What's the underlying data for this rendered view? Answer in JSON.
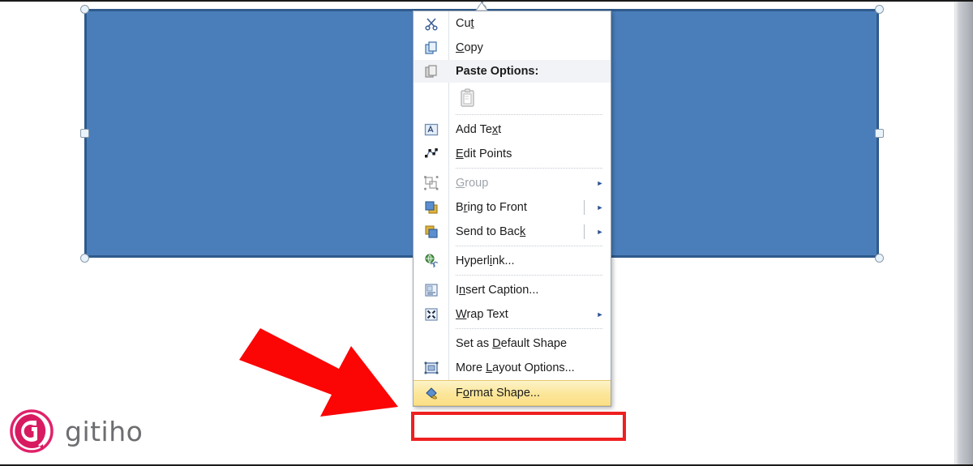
{
  "app": {
    "context": "word-shape-context-menu",
    "canvas_background": "#ffffff"
  },
  "shape": {
    "name": "blue-rectangle-shape",
    "fill_color": "#4a7ebb",
    "border_color": "#2f5a8c",
    "selected": true,
    "handles": [
      "top-left",
      "top-right",
      "bottom-left",
      "bottom-right",
      "middle-left",
      "middle-right",
      "rotation"
    ]
  },
  "annotation": {
    "arrow_color": "#ff0000",
    "highlight_box_color": "#ef2020",
    "highlight_target": "Format Shape..."
  },
  "logo": {
    "name": "gitiho",
    "text": "gitiho",
    "mark_color": "#e0226a",
    "text_color": "#6d6e71"
  },
  "context_menu": {
    "items": [
      {
        "id": "cut",
        "label": "Cut",
        "icon": "scissors-icon",
        "accel": "t",
        "type": "item",
        "disabled": false,
        "submenu": false,
        "separator_below": false
      },
      {
        "id": "copy",
        "label": "Copy",
        "icon": "copy-icon",
        "accel": "C",
        "type": "item",
        "disabled": false,
        "submenu": false,
        "separator_below": false
      },
      {
        "id": "paste-options",
        "label": "Paste Options:",
        "icon": "paste-icon",
        "type": "header",
        "disabled": false,
        "submenu": false,
        "separator_below": false
      },
      {
        "id": "paste-keep-source",
        "label": "",
        "icon": "clipboard-document-icon",
        "type": "paste-button-row",
        "disabled": true,
        "submenu": false,
        "separator_below": true
      },
      {
        "id": "add-text",
        "label": "Add Text",
        "icon": "add-text-icon",
        "accel": "x",
        "type": "item",
        "disabled": false,
        "submenu": false,
        "separator_below": false
      },
      {
        "id": "edit-points",
        "label": "Edit Points",
        "icon": "edit-points-icon",
        "accel": "E",
        "type": "item",
        "disabled": false,
        "submenu": false,
        "separator_below": true
      },
      {
        "id": "group",
        "label": "Group",
        "icon": "group-icon",
        "accel": "G",
        "type": "item",
        "disabled": true,
        "submenu": true,
        "separator_below": false
      },
      {
        "id": "bring-to-front",
        "label": "Bring to Front",
        "icon": "bring-to-front-icon",
        "accel": "r",
        "type": "item",
        "disabled": false,
        "submenu": true,
        "separator_below": false
      },
      {
        "id": "send-to-back",
        "label": "Send to Back",
        "icon": "send-to-back-icon",
        "accel": "k",
        "type": "item",
        "disabled": false,
        "submenu": true,
        "separator_below": true
      },
      {
        "id": "hyperlink",
        "label": "Hyperlink...",
        "icon": "hyperlink-globe-icon",
        "accel": "i",
        "type": "item",
        "disabled": false,
        "submenu": false,
        "separator_below": true
      },
      {
        "id": "insert-caption",
        "label": "Insert Caption...",
        "icon": "insert-caption-icon",
        "accel": "n",
        "type": "item",
        "disabled": false,
        "submenu": false,
        "separator_below": false
      },
      {
        "id": "wrap-text",
        "label": "Wrap Text",
        "icon": "wrap-text-icon",
        "accel": "W",
        "type": "item",
        "disabled": false,
        "submenu": true,
        "separator_below": true
      },
      {
        "id": "set-as-default-shape",
        "label": "Set as Default Shape",
        "icon": "",
        "accel": "D",
        "type": "item",
        "disabled": false,
        "submenu": false,
        "separator_below": false
      },
      {
        "id": "more-layout-options",
        "label": "More Layout Options...",
        "icon": "layout-options-icon",
        "accel": "L",
        "type": "item",
        "disabled": false,
        "submenu": false,
        "separator_below": false
      },
      {
        "id": "format-shape",
        "label": "Format Shape...",
        "icon": "format-shape-paint-icon",
        "accel": "o",
        "type": "item",
        "disabled": false,
        "submenu": false,
        "separator_below": false,
        "highlighted": true
      }
    ]
  }
}
